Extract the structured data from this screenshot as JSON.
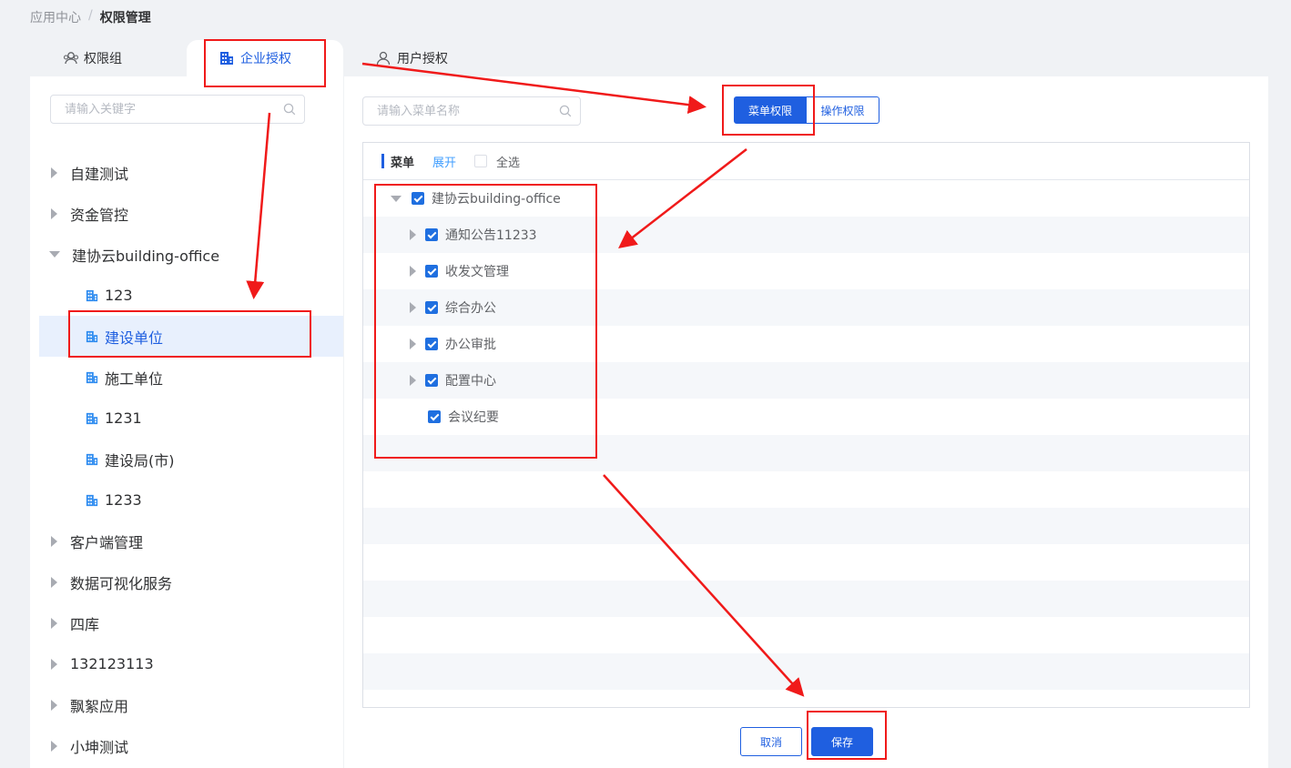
{
  "breadcrumb": {
    "parent": "应用中心",
    "separator": "/",
    "current": "权限管理"
  },
  "tabs": {
    "group": "权限组",
    "corp": "企业授权",
    "user": "用户授权"
  },
  "left": {
    "search_placeholder": "请输入关键字",
    "items": [
      {
        "label": "自建测试"
      },
      {
        "label": "资金管控"
      },
      {
        "label": "建协云building-office"
      },
      {
        "label": "123"
      },
      {
        "label": "建设单位"
      },
      {
        "label": "施工单位"
      },
      {
        "label": "1231"
      },
      {
        "label": "建设局(市)"
      },
      {
        "label": "1233"
      },
      {
        "label": "客户端管理"
      },
      {
        "label": "数据可视化服务"
      },
      {
        "label": "四库"
      },
      {
        "label": "132123113"
      },
      {
        "label": "飘絮应用"
      },
      {
        "label": "小坤测试"
      }
    ]
  },
  "main": {
    "search_placeholder": "请输入菜单名称",
    "menu_permission": "菜单权限",
    "operation_permission": "操作权限",
    "menu_title": "菜单",
    "expand": "展开",
    "select_all": "全选",
    "tree": [
      {
        "label": "建协云building-office"
      },
      {
        "label": "通知公告11233"
      },
      {
        "label": "收发文管理"
      },
      {
        "label": "综合办公"
      },
      {
        "label": "办公审批"
      },
      {
        "label": "配置中心"
      },
      {
        "label": "会议纪要"
      }
    ],
    "cancel": "取消",
    "save": "保存"
  },
  "colors": {
    "primary": "#1f5fe0",
    "annotation": "#f01a1a",
    "selected_bg": "#e8f0fd"
  }
}
